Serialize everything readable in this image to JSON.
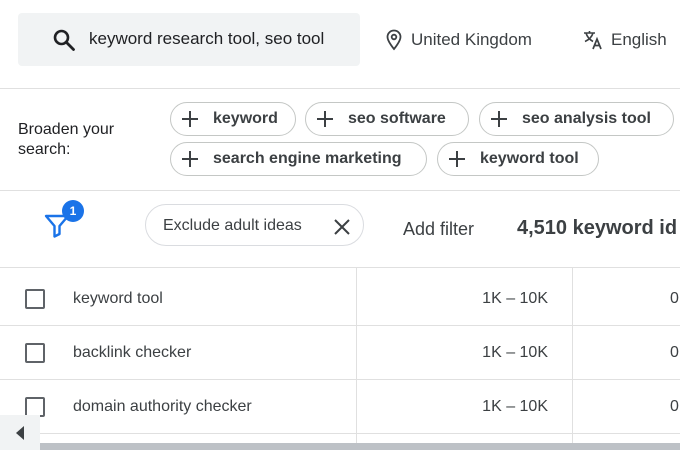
{
  "search": {
    "query": "keyword research tool, seo tool",
    "location": "United Kingdom",
    "language": "English"
  },
  "broaden": {
    "label": "Broaden your search:",
    "chips": [
      "keyword",
      "seo software",
      "seo analysis tool",
      "search engine marketing",
      "keyword tool"
    ]
  },
  "filters": {
    "badge_count": "1",
    "active_filter": "Exclude adult ideas",
    "add_filter": "Add filter",
    "keyword_count": "4,510 keyword id"
  },
  "table": {
    "rows": [
      {
        "keyword": "keyword tool",
        "volume": "1K – 10K",
        "next": "0"
      },
      {
        "keyword": "backlink checker",
        "volume": "1K – 10K",
        "next": "0"
      },
      {
        "keyword": "domain authority checker",
        "volume": "1K – 10K",
        "next": "0"
      }
    ]
  },
  "icons": {
    "search": "search-icon",
    "location": "location-pin-icon",
    "language": "translate-icon",
    "filter": "filter-icon",
    "close": "close-icon",
    "plus": "plus-icon",
    "scroll_left": "chevron-left-icon"
  },
  "colors": {
    "accent": "#1a73e8",
    "chip_border": "#c4c7c5",
    "search_bg": "#f1f3f4"
  }
}
